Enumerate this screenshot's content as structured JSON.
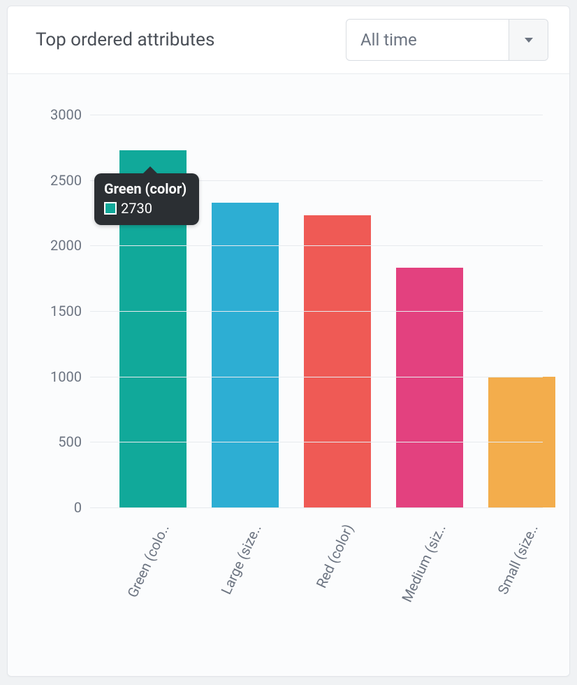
{
  "header": {
    "title": "Top ordered attributes",
    "period_selected": "All time"
  },
  "tooltip": {
    "title": "Green (color)",
    "value": "2730",
    "swatch_color": "#11a99a"
  },
  "chart_data": {
    "type": "bar",
    "title": "Top ordered attributes",
    "xlabel": "",
    "ylabel": "",
    "ylim": [
      0,
      3000
    ],
    "y_ticks": [
      0,
      500,
      1000,
      1500,
      2000,
      2500,
      3000
    ],
    "categories_full": [
      "Green (color)",
      "Large (size)",
      "Red (color)",
      "Medium (size)",
      "Small (size)"
    ],
    "categories": [
      "Green (colo..",
      "Large (size..",
      "Red (color)",
      "Medium (siz..",
      "Small (size.."
    ],
    "values": [
      2730,
      2330,
      2230,
      1830,
      1000
    ],
    "colors": [
      "#11a99a",
      "#2daed3",
      "#ef5a55",
      "#e3417f",
      "#f3ad4c"
    ],
    "grid": true,
    "legend": false
  }
}
